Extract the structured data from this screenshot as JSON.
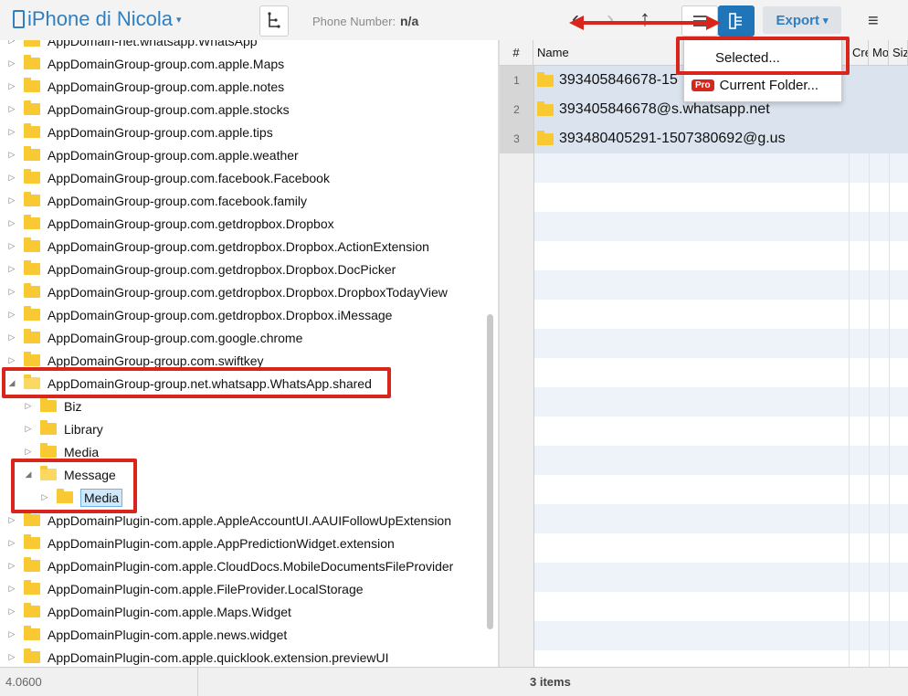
{
  "toolbar": {
    "device_title": "iPhone di Nicola",
    "phone_number_label": "Phone Number:",
    "phone_number_value": "n/a",
    "export_label": "Export",
    "menu_glyph": "≡"
  },
  "tree": [
    {
      "label": "AppDomain-net.whatsapp.WhatsApp",
      "depth": 0,
      "expanded": false
    },
    {
      "label": "AppDomainGroup-group.com.apple.Maps",
      "depth": 0,
      "expanded": false
    },
    {
      "label": "AppDomainGroup-group.com.apple.notes",
      "depth": 0,
      "expanded": false
    },
    {
      "label": "AppDomainGroup-group.com.apple.stocks",
      "depth": 0,
      "expanded": false
    },
    {
      "label": "AppDomainGroup-group.com.apple.tips",
      "depth": 0,
      "expanded": false
    },
    {
      "label": "AppDomainGroup-group.com.apple.weather",
      "depth": 0,
      "expanded": false
    },
    {
      "label": "AppDomainGroup-group.com.facebook.Facebook",
      "depth": 0,
      "expanded": false
    },
    {
      "label": "AppDomainGroup-group.com.facebook.family",
      "depth": 0,
      "expanded": false
    },
    {
      "label": "AppDomainGroup-group.com.getdropbox.Dropbox",
      "depth": 0,
      "expanded": false
    },
    {
      "label": "AppDomainGroup-group.com.getdropbox.Dropbox.ActionExtension",
      "depth": 0,
      "expanded": false
    },
    {
      "label": "AppDomainGroup-group.com.getdropbox.Dropbox.DocPicker",
      "depth": 0,
      "expanded": false
    },
    {
      "label": "AppDomainGroup-group.com.getdropbox.Dropbox.DropboxTodayView",
      "depth": 0,
      "expanded": false
    },
    {
      "label": "AppDomainGroup-group.com.getdropbox.Dropbox.iMessage",
      "depth": 0,
      "expanded": false
    },
    {
      "label": "AppDomainGroup-group.com.google.chrome",
      "depth": 0,
      "expanded": false
    },
    {
      "label": "AppDomainGroup-group.com.swiftkey",
      "depth": 0,
      "expanded": false
    },
    {
      "label": "AppDomainGroup-group.net.whatsapp.WhatsApp.shared",
      "depth": 0,
      "expanded": true
    },
    {
      "label": "Biz",
      "depth": 1,
      "expanded": false
    },
    {
      "label": "Library",
      "depth": 1,
      "expanded": false
    },
    {
      "label": "Media",
      "depth": 1,
      "expanded": false
    },
    {
      "label": "Message",
      "depth": 1,
      "expanded": true
    },
    {
      "label": "Media",
      "depth": 2,
      "expanded": false,
      "selected": true
    },
    {
      "label": "AppDomainPlugin-com.apple.AppleAccountUI.AAUIFollowUpExtension",
      "depth": 0,
      "expanded": false
    },
    {
      "label": "AppDomainPlugin-com.apple.AppPredictionWidget.extension",
      "depth": 0,
      "expanded": false
    },
    {
      "label": "AppDomainPlugin-com.apple.CloudDocs.MobileDocumentsFileProvider",
      "depth": 0,
      "expanded": false
    },
    {
      "label": "AppDomainPlugin-com.apple.FileProvider.LocalStorage",
      "depth": 0,
      "expanded": false
    },
    {
      "label": "AppDomainPlugin-com.apple.Maps.Widget",
      "depth": 0,
      "expanded": false
    },
    {
      "label": "AppDomainPlugin-com.apple.news.widget",
      "depth": 0,
      "expanded": false
    },
    {
      "label": "AppDomainPlugin-com.apple.quicklook.extension.previewUI",
      "depth": 0,
      "expanded": false
    }
  ],
  "grid": {
    "columns": [
      "#",
      "Name",
      "Cre",
      "Mo",
      "Siz"
    ],
    "rows": [
      {
        "num": "1",
        "name": "393405846678-15"
      },
      {
        "num": "2",
        "name": "393405846678@s.whatsapp.net"
      },
      {
        "num": "3",
        "name": "393480405291-1507380692@g.us"
      }
    ]
  },
  "dropdown": {
    "items": [
      "Selected...",
      "Current Folder..."
    ],
    "pro_badge": "Pro"
  },
  "status": {
    "version": "4.0600",
    "items_count": "3 items"
  },
  "colors": {
    "accent": "#2f7fc1",
    "active_button": "#1f75b8",
    "annotation_red": "#d9261c",
    "folder_yellow": "#f8c932",
    "selected_row": "#dbe3ee"
  }
}
